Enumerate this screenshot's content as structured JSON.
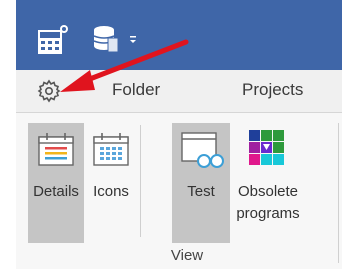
{
  "ribbon_tabs": {
    "folder": "Folder",
    "projects": "Projects"
  },
  "view_group": {
    "label": "View",
    "buttons": {
      "details": "Details",
      "icons": "Icons",
      "test": "Test",
      "obsolete_line1": "Obsolete",
      "obsolete_line2": "programs"
    }
  },
  "colors": {
    "titlebar": "#3f66a8",
    "annotation_arrow": "#e0141e",
    "selected_button": "#c5c5c5"
  },
  "icons": [
    "calculator-app-icon",
    "database-icon",
    "quick-access-dropdown-icon",
    "gear-icon",
    "calendar-details-icon",
    "calendar-icons-icon",
    "test-glasses-icon",
    "obsolete-grid-icon"
  ]
}
